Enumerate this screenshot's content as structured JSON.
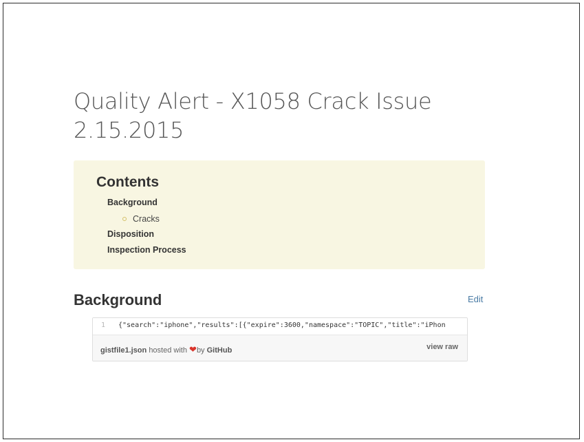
{
  "page": {
    "title": "Quality Alert - X1058 Crack Issue 2.15.2015"
  },
  "toc": {
    "title": "Contents",
    "items": [
      {
        "label": "Background"
      },
      {
        "label": "Cracks"
      },
      {
        "label": "Disposition"
      },
      {
        "label": "Inspection Process"
      }
    ]
  },
  "section": {
    "heading": "Background",
    "edit_label": "Edit"
  },
  "gist": {
    "line_number": "1",
    "code": "{\"search\":\"iphone\",\"results\":[{\"expire\":3600,\"namespace\":\"TOPIC\",\"title\":\"iPhon",
    "filename": "gistfile1.json",
    "hosted_with": "hosted with",
    "heart": "❤",
    "by": "by",
    "github": "GitHub",
    "view_raw": "view raw"
  },
  "colors": {
    "toc_background": "#f8f6e2",
    "link": "#4a7ba5",
    "heart": "#d9342b",
    "bullet": "#d4c068"
  }
}
